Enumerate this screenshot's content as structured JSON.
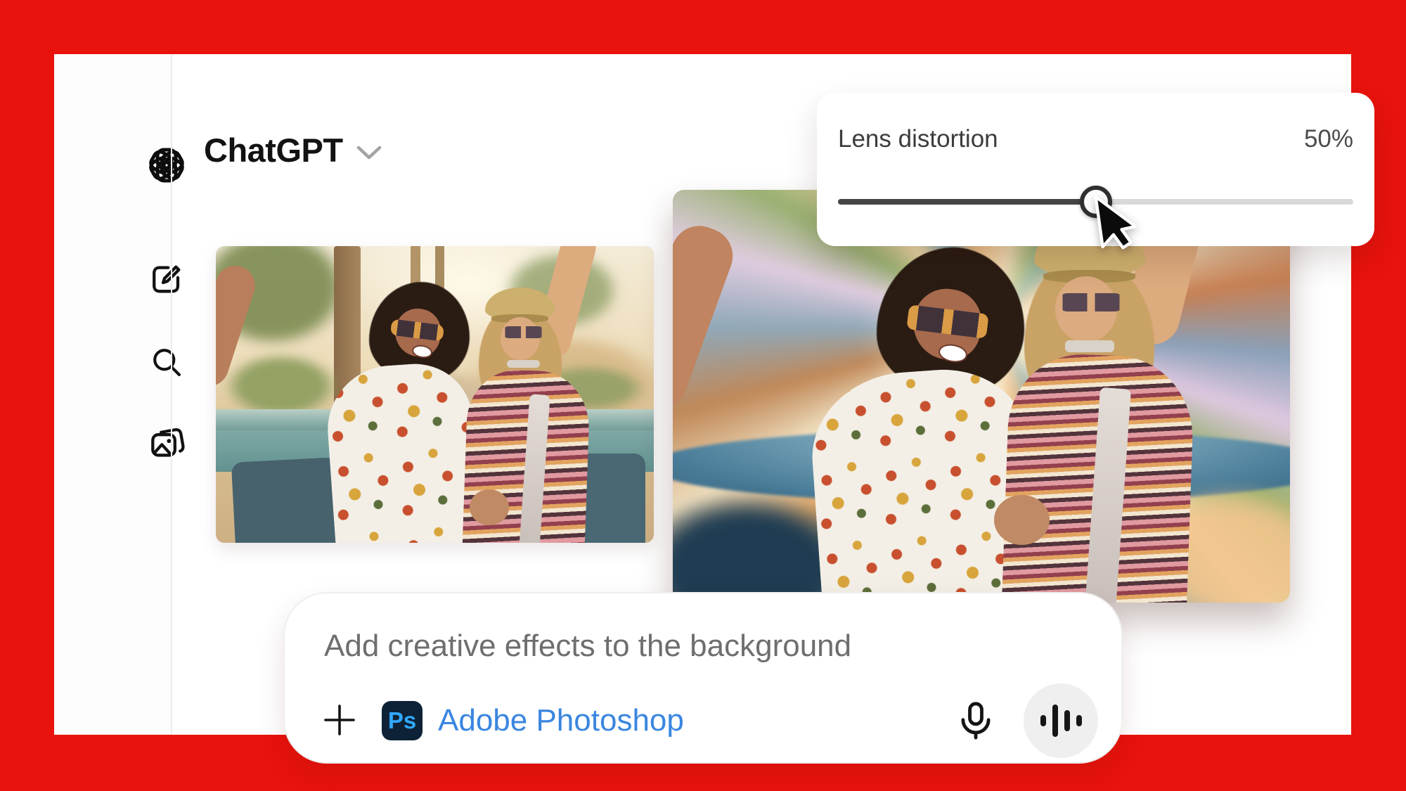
{
  "header": {
    "title": "ChatGPT"
  },
  "sidebar": {
    "items": [
      {
        "icon": "openai-logo"
      },
      {
        "icon": "new-chat"
      },
      {
        "icon": "search"
      },
      {
        "icon": "library"
      }
    ]
  },
  "effects_panel": {
    "label": "Lens distortion",
    "value": "50%",
    "slider_percent": 50
  },
  "composer": {
    "prompt": "Add creative effects to the background",
    "connector": {
      "badge": "Ps",
      "name": "Adobe Photoshop"
    },
    "icons": {
      "attach": "plus-icon",
      "dictate": "microphone-icon",
      "voice": "voice-mode-icon"
    }
  },
  "colors": {
    "frame_red": "#e8130c",
    "link_blue": "#3a86e0",
    "ps_badge_bg": "#0d2236",
    "ps_badge_text": "#31a8ff",
    "slider_fill": "#454545",
    "slider_track": "#d9d9d9"
  }
}
